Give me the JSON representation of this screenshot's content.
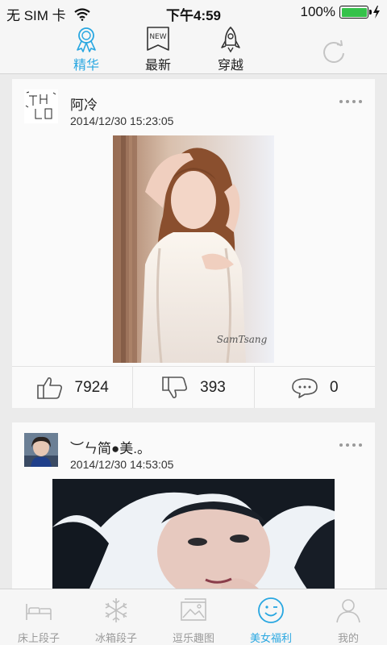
{
  "status_bar": {
    "carrier": "无 SIM 卡",
    "time": "下午4:59",
    "battery_percent": "100%",
    "battery_level": 1.0
  },
  "top_tabs": [
    {
      "label": "精华",
      "icon": "award-ribbon-icon",
      "active": true
    },
    {
      "label": "最新",
      "icon": "new-badge-icon",
      "active": false
    },
    {
      "label": "穿越",
      "icon": "rocket-icon",
      "active": false
    }
  ],
  "refresh_icon": "refresh-icon",
  "posts": [
    {
      "user": "阿冷",
      "timestamp": "2014/12/30 15:23:05",
      "likes": "7924",
      "dislikes": "393",
      "comments": "0",
      "watermark": "SamTsang"
    },
    {
      "user": "︶ㄣ简●美.。",
      "timestamp": "2014/12/30 14:53:05"
    }
  ],
  "bottom_tabs": [
    {
      "label": "床上段子",
      "icon": "bed-icon",
      "active": false
    },
    {
      "label": "冰箱段子",
      "icon": "snowflake-icon",
      "active": false
    },
    {
      "label": "逗乐趣图",
      "icon": "picture-icon",
      "active": false
    },
    {
      "label": "美女福利",
      "icon": "smiley-icon",
      "active": true
    },
    {
      "label": "我的",
      "icon": "user-icon",
      "active": false
    }
  ],
  "colors": {
    "accent": "#29a7e1",
    "inactive": "#9a9a9a",
    "battery": "#35c24a"
  }
}
